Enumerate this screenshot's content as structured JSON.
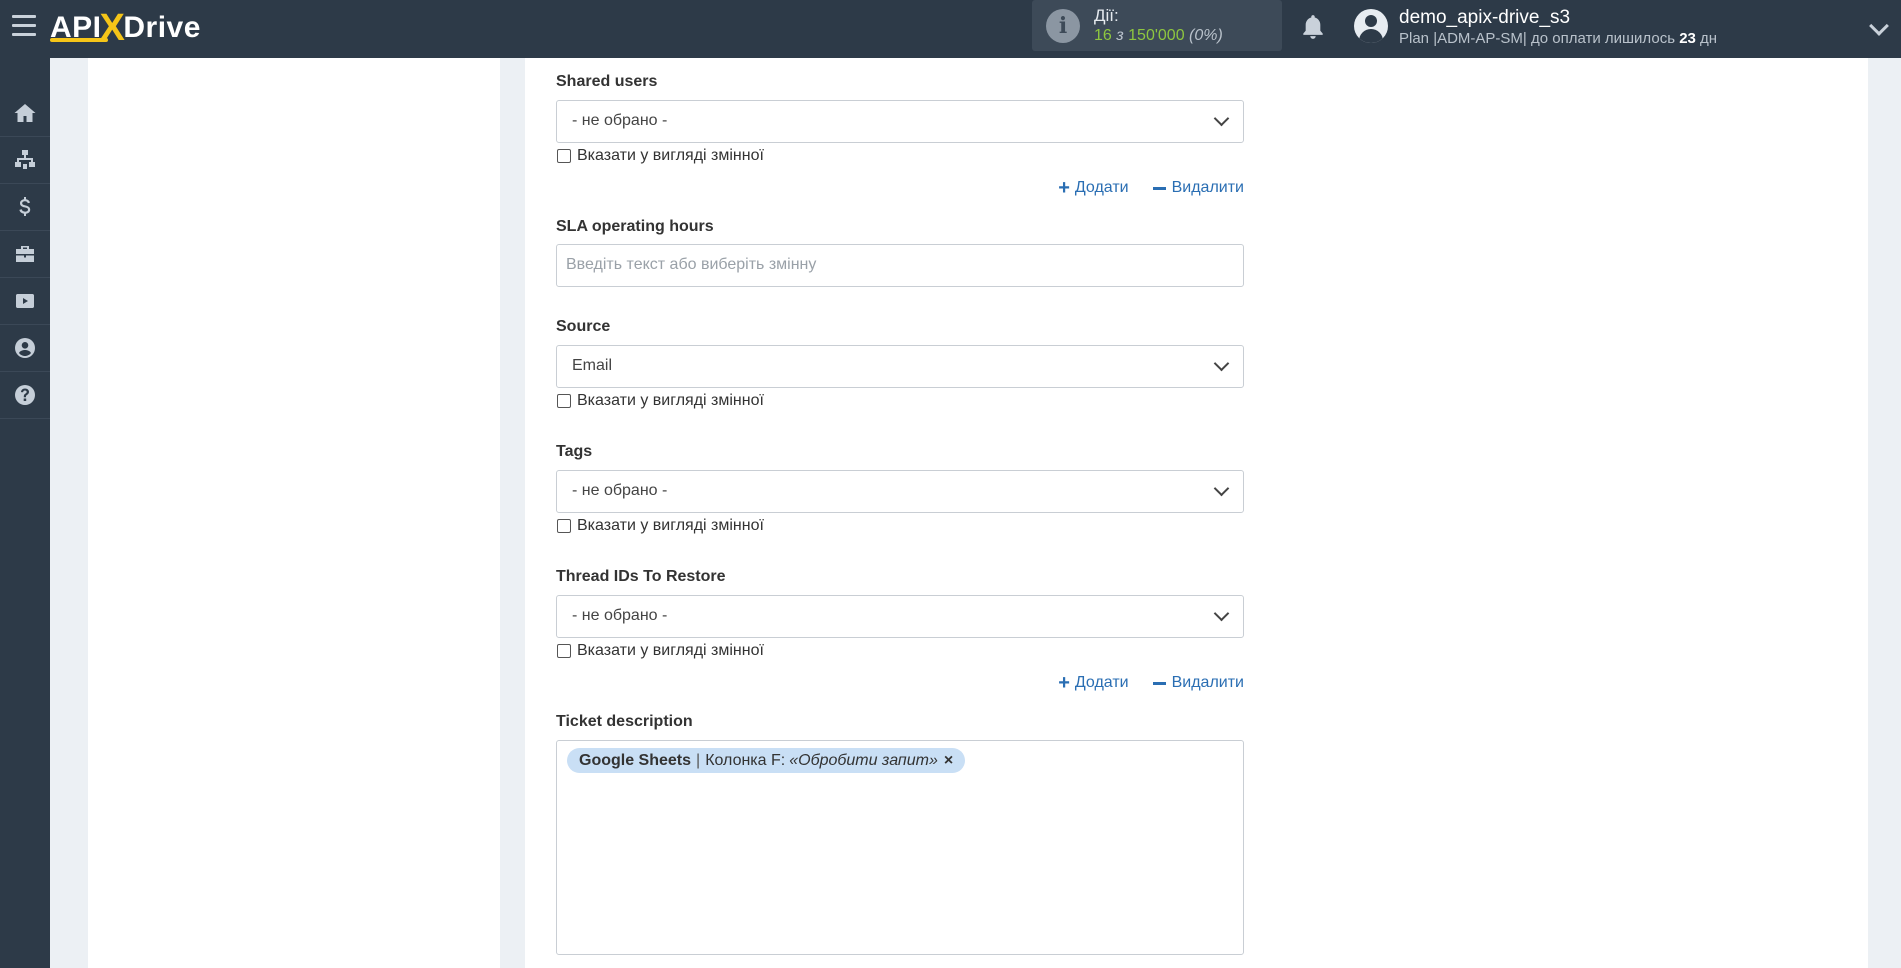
{
  "header": {
    "logo_left": "API",
    "logo_x": "X",
    "logo_right": "Drive",
    "actions_label": "Дії:",
    "actions_count": "16",
    "actions_of": "з",
    "actions_total": "150'000",
    "actions_percent": "(0%)",
    "user_name": "demo_apix-drive_s3",
    "plan_prefix": "Plan |ADM-AP-SM| до оплати лишилось",
    "plan_days": "23",
    "plan_suffix": "дн"
  },
  "sidebar": {
    "items": [
      "home-icon",
      "sitemap-icon",
      "dollar-icon",
      "briefcase-icon",
      "youtube-icon",
      "user-circle-icon",
      "help-icon"
    ]
  },
  "form": {
    "shared_users": {
      "label": "Shared users",
      "value": "- не обрано -",
      "checkbox_label": "Вказати у вигляді змінної"
    },
    "add_label": "Додати",
    "remove_label": "Видалити",
    "sla": {
      "label": "SLA operating hours",
      "placeholder": "Введіть текст або виберіть змінну"
    },
    "source": {
      "label": "Source",
      "value": "Email",
      "checkbox_label": "Вказати у вигляді змінної"
    },
    "tags": {
      "label": "Tags",
      "value": "- не обрано -",
      "checkbox_label": "Вказати у вигляді змінної"
    },
    "thread_ids": {
      "label": "Thread IDs To Restore",
      "value": "- не обрано -",
      "checkbox_label": "Вказати у вигляді змінної"
    },
    "ticket_description": {
      "label": "Ticket description",
      "tag_source": "Google Sheets",
      "tag_sep": "|",
      "tag_field": "Колонка F:",
      "tag_value": "«Обробити запит»",
      "tag_remove": "×"
    }
  }
}
